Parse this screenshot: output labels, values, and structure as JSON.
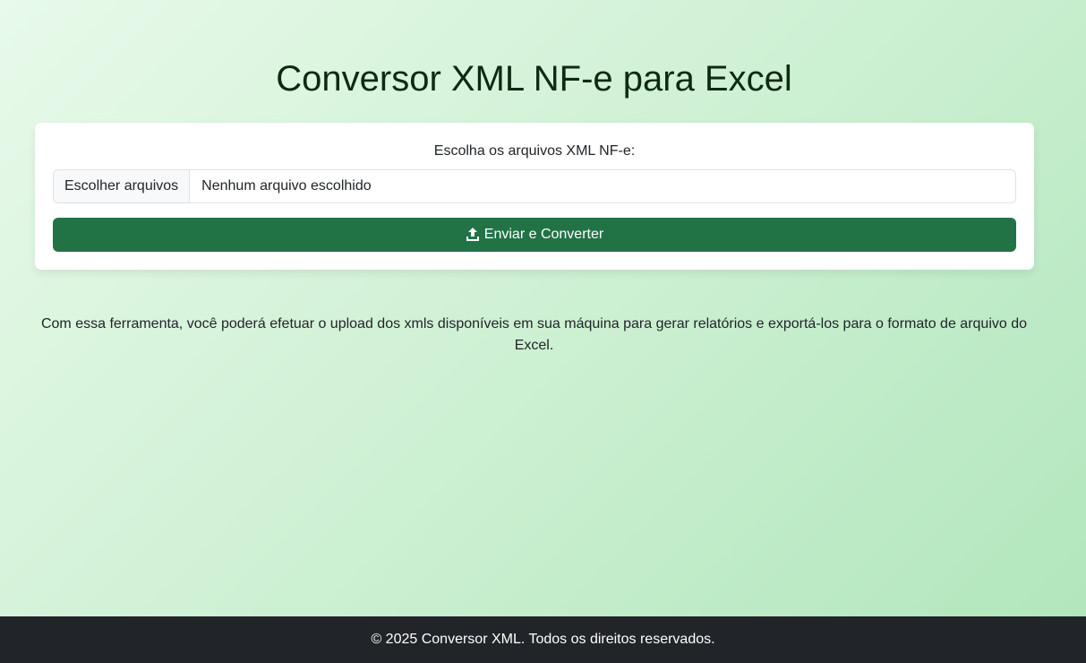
{
  "header": {
    "title": "Conversor XML NF-e para Excel"
  },
  "upload": {
    "label": "Escolha os arquivos XML NF-e:",
    "choose_button": "Escolher arquivos",
    "file_status": "Nenhum arquivo escolhido",
    "submit_label": "Enviar e Converter",
    "submit_icon": "upload-icon"
  },
  "description": "Com essa ferramenta, você poderá efetuar o upload dos xmls disponíveis em sua máquina para gerar relatórios e exportá-los para o formato de arquivo do Excel.",
  "footer": {
    "text": "© 2025 Conversor XML. Todos os direitos reservados."
  },
  "colors": {
    "primary_button": "#217346",
    "footer_bg": "#212529",
    "title": "#0f2a12"
  }
}
